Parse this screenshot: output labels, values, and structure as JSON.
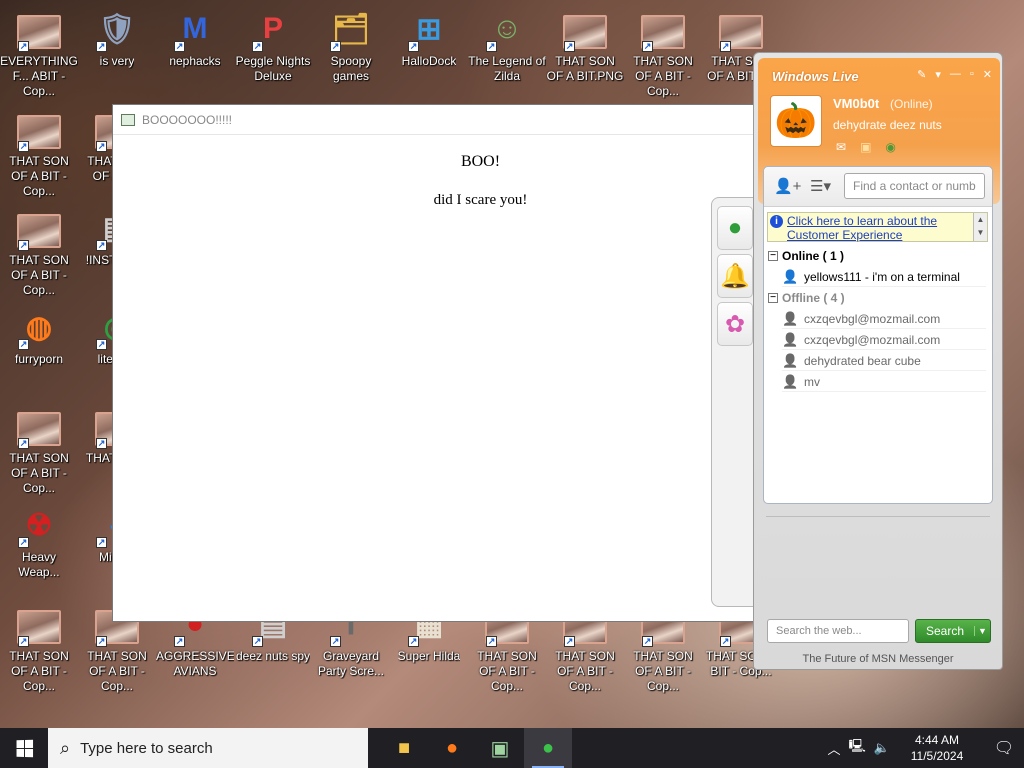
{
  "desktop": {
    "icons": [
      {
        "label": "EVERYTHING F... ABIT - Cop...",
        "kind": "photo"
      },
      {
        "label": "is very",
        "kind": "shield"
      },
      {
        "label": "nephacks",
        "kind": "mpi"
      },
      {
        "label": "Peggle Nights Deluxe",
        "kind": "peggle"
      },
      {
        "label": "Spoopy games",
        "kind": "folder"
      },
      {
        "label": "HalloDock",
        "kind": "windows"
      },
      {
        "label": "The Legend of Zilda",
        "kind": "zilda"
      },
      {
        "label": "THAT SON OF A BIT.PNG",
        "kind": "photo"
      },
      {
        "label": "THAT SON OF A BIT - Cop...",
        "kind": "photo"
      },
      {
        "label": "THAT SON OF A BIT - C",
        "kind": "photo"
      },
      {
        "label": "THAT SON OF A BIT - Cop...",
        "kind": "photo"
      },
      {
        "label": "THAT SON OF A BIT",
        "kind": "photo"
      },
      {
        "label": "THAT SON OF A BIT - Cop...",
        "kind": "photo"
      },
      {
        "label": "!INSTA - Sh",
        "kind": "doc"
      },
      {
        "label": "furryporn",
        "kind": "firefox"
      },
      {
        "label": "lite unu",
        "kind": "chrome"
      },
      {
        "label": "THAT SON OF A BIT - Cop...",
        "kind": "photo"
      },
      {
        "label": "THAT A BIT",
        "kind": "photo"
      },
      {
        "label": "Heavy Weap...",
        "kind": "radiation"
      },
      {
        "label": "Mic Ec",
        "kind": "edge"
      },
      {
        "label": "THAT SON OF A BIT - Cop...",
        "kind": "photo"
      },
      {
        "label": "THAT SON OF A BIT - Cop...",
        "kind": "photo"
      },
      {
        "label": "AGGRESSIVE AVIANS",
        "kind": "bird"
      },
      {
        "label": "deez nuts spy",
        "kind": "doc"
      },
      {
        "label": "Graveyard Party Scre...",
        "kind": "grave"
      },
      {
        "label": "Super Hilda",
        "kind": "hilda"
      },
      {
        "label": "THAT SON OF A BIT - Cop...",
        "kind": "photo"
      },
      {
        "label": "THAT SON OF A BIT - Cop...",
        "kind": "photo"
      },
      {
        "label": "THAT SON OF A BIT - Cop...",
        "kind": "photo"
      },
      {
        "label": "THAT SON A BIT - Cop...",
        "kind": "photo"
      }
    ]
  },
  "boo_window": {
    "title": "BOOOOOOO!!!!!",
    "heading": "BOO!",
    "text": "did I scare you!"
  },
  "messenger": {
    "logo": "Windows Live",
    "user_name": "VM0b0t",
    "status": "(Online)",
    "personal_message": "dehydrate deez nuts",
    "find_placeholder": "Find a contact or number",
    "notice": "Click here to learn about the Customer Experience",
    "online_group": "Online ( 1 )",
    "offline_group": "Offline ( 4 )",
    "online_contacts": [
      "yellows111 - i'm on a terminal"
    ],
    "offline_contacts": [
      "cxzqevbgl@mozmail.com",
      "cxzqevbgl@mozmail.com",
      "dehydrated bear cube",
      "mv"
    ],
    "web_search_placeholder": "Search the web...",
    "search_label": "Search",
    "footer": "The Future of MSN Messenger",
    "colors": {
      "header": "#f5a14c",
      "online": "#2e9d3a",
      "offline_group": "#8a8a8a",
      "link": "#1f3fbf"
    }
  },
  "taskbar": {
    "search_placeholder": "Type here to search",
    "time": "4:44 AM",
    "date": "11/5/2024"
  }
}
